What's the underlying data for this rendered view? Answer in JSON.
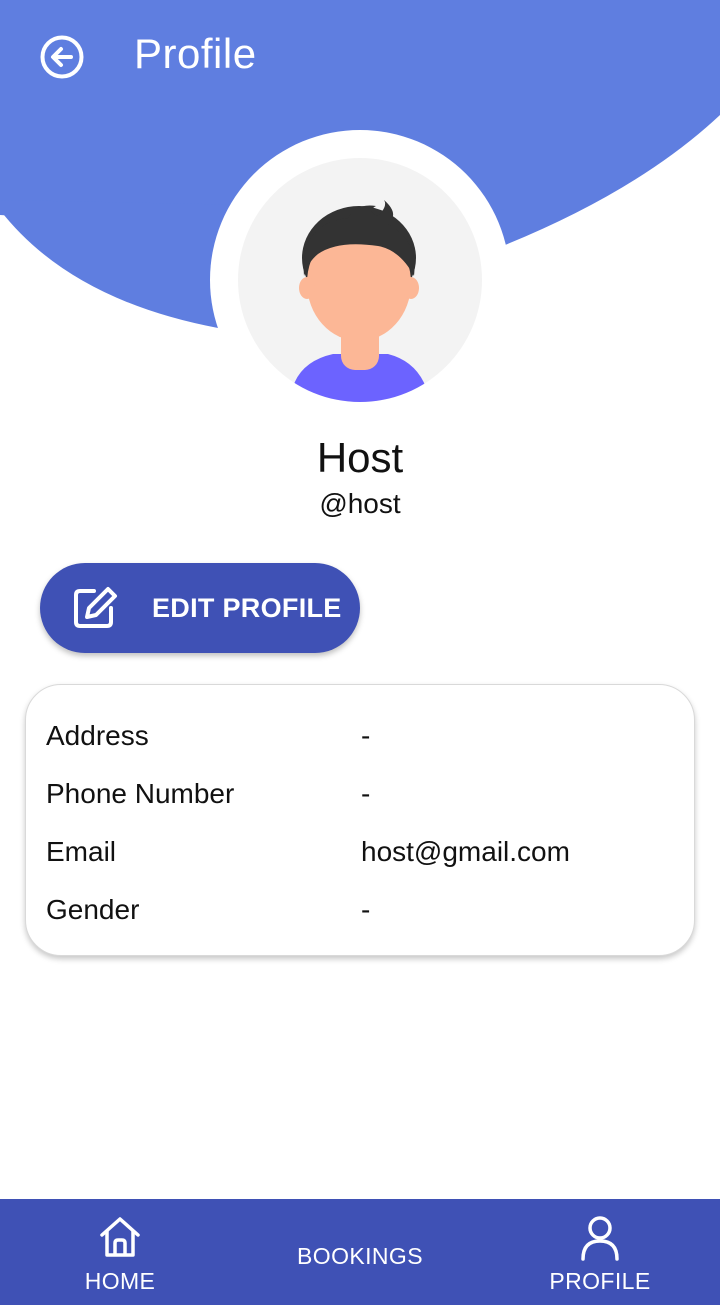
{
  "header": {
    "title": "Profile",
    "back_icon": "arrow-left-circle-icon"
  },
  "colors": {
    "hero_blue": "#5f7ee0",
    "primary": "#3f51b5",
    "avatar_shirt": "#6c63ff"
  },
  "profile": {
    "name": "Host",
    "handle": "@host",
    "avatar_icon": "user-avatar-illustration"
  },
  "edit_button": {
    "label": "EDIT PROFILE",
    "icon": "edit-icon"
  },
  "info": [
    {
      "label": "Address",
      "value": "-"
    },
    {
      "label": "Phone Number",
      "value": "-"
    },
    {
      "label": "Email",
      "value": "host@gmail.com"
    },
    {
      "label": "Gender",
      "value": "-"
    }
  ],
  "nav": {
    "home": {
      "label": "HOME",
      "icon": "home-icon"
    },
    "bookings": {
      "label": "BOOKINGS"
    },
    "profile": {
      "label": "PROFILE",
      "icon": "person-icon"
    }
  }
}
